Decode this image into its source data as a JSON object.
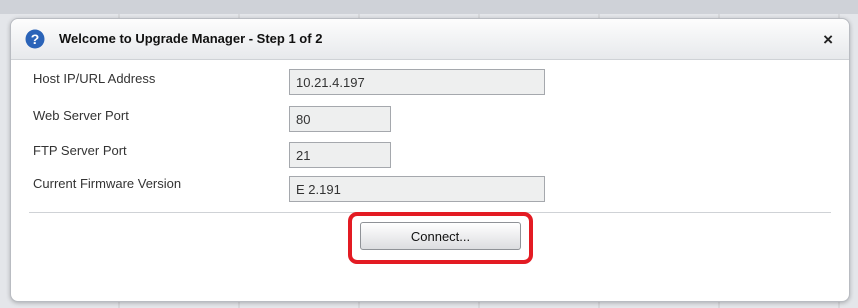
{
  "dialog": {
    "title": "Welcome to Upgrade Manager - Step 1 of 2",
    "close_glyph": "×",
    "help_glyph": "?"
  },
  "form": {
    "host_label": "Host IP/URL Address",
    "host_value": "10.21.4.197",
    "web_port_label": "Web Server Port",
    "web_port_value": "80",
    "ftp_port_label": "FTP Server Port",
    "ftp_port_value": "21",
    "firmware_label": "Current Firmware Version",
    "firmware_value": "E 2.191"
  },
  "actions": {
    "connect_label": "Connect..."
  },
  "colors": {
    "help_icon": "#2a63b8",
    "highlight": "#e31b23"
  }
}
